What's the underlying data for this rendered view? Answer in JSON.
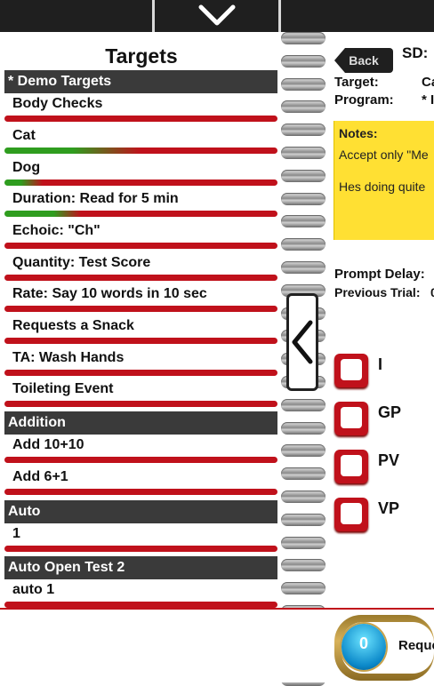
{
  "targets_panel": {
    "title": "Targets",
    "sections": [
      {
        "name": "* Demo Targets",
        "items": [
          {
            "label": "Body Checks",
            "bar": "red"
          },
          {
            "label": "Cat",
            "bar": "green-red"
          },
          {
            "label": "Dog",
            "bar": "green-red-short"
          },
          {
            "label": "Duration: Read for 5 min",
            "bar": "green-red"
          },
          {
            "label": "Echoic: \"Ch\"",
            "bar": "red"
          },
          {
            "label": "Quantity: Test Score",
            "bar": "red"
          },
          {
            "label": "Rate: Say 10 words in 10 sec",
            "bar": "red"
          },
          {
            "label": "Requests a Snack",
            "bar": "red"
          },
          {
            "label": "TA: Wash Hands",
            "bar": "red"
          },
          {
            "label": "Toileting Event",
            "bar": "red"
          }
        ]
      },
      {
        "name": "Addition",
        "items": [
          {
            "label": "Add 10+10",
            "bar": "red"
          },
          {
            "label": "Add 6+1",
            "bar": "red"
          }
        ]
      },
      {
        "name": "Auto",
        "items": [
          {
            "label": "1",
            "bar": "red"
          }
        ]
      },
      {
        "name": "Auto Open Test 2",
        "items": [
          {
            "label": "auto 1",
            "bar": "red"
          }
        ]
      }
    ]
  },
  "detail_panel": {
    "back_label": "Back",
    "sd_label": "SD:",
    "target_label": "Target:",
    "target_value": "Ca",
    "program_label": "Program:",
    "program_value": "* I",
    "notes_title": "Notes:",
    "notes_line1": "Accept only \"Me",
    "notes_line2": "Hes doing quite",
    "prompt_delay_label": "Prompt Delay:",
    "previous_trial_label": "Previous Trial:",
    "previous_trial_value": "0",
    "prompts": [
      "I",
      "GP",
      "PV",
      "VP"
    ]
  },
  "request_button": {
    "count": "0",
    "label": "Reque"
  },
  "icons": {
    "top_toggle": "chevron-down-icon",
    "side_toggle": "chevron-left-icon"
  },
  "colors": {
    "bar_red": "#c0111b",
    "bar_green": "#2f9d1f",
    "notes_bg": "#ffe033",
    "header_bg": "#1f1f1f"
  }
}
